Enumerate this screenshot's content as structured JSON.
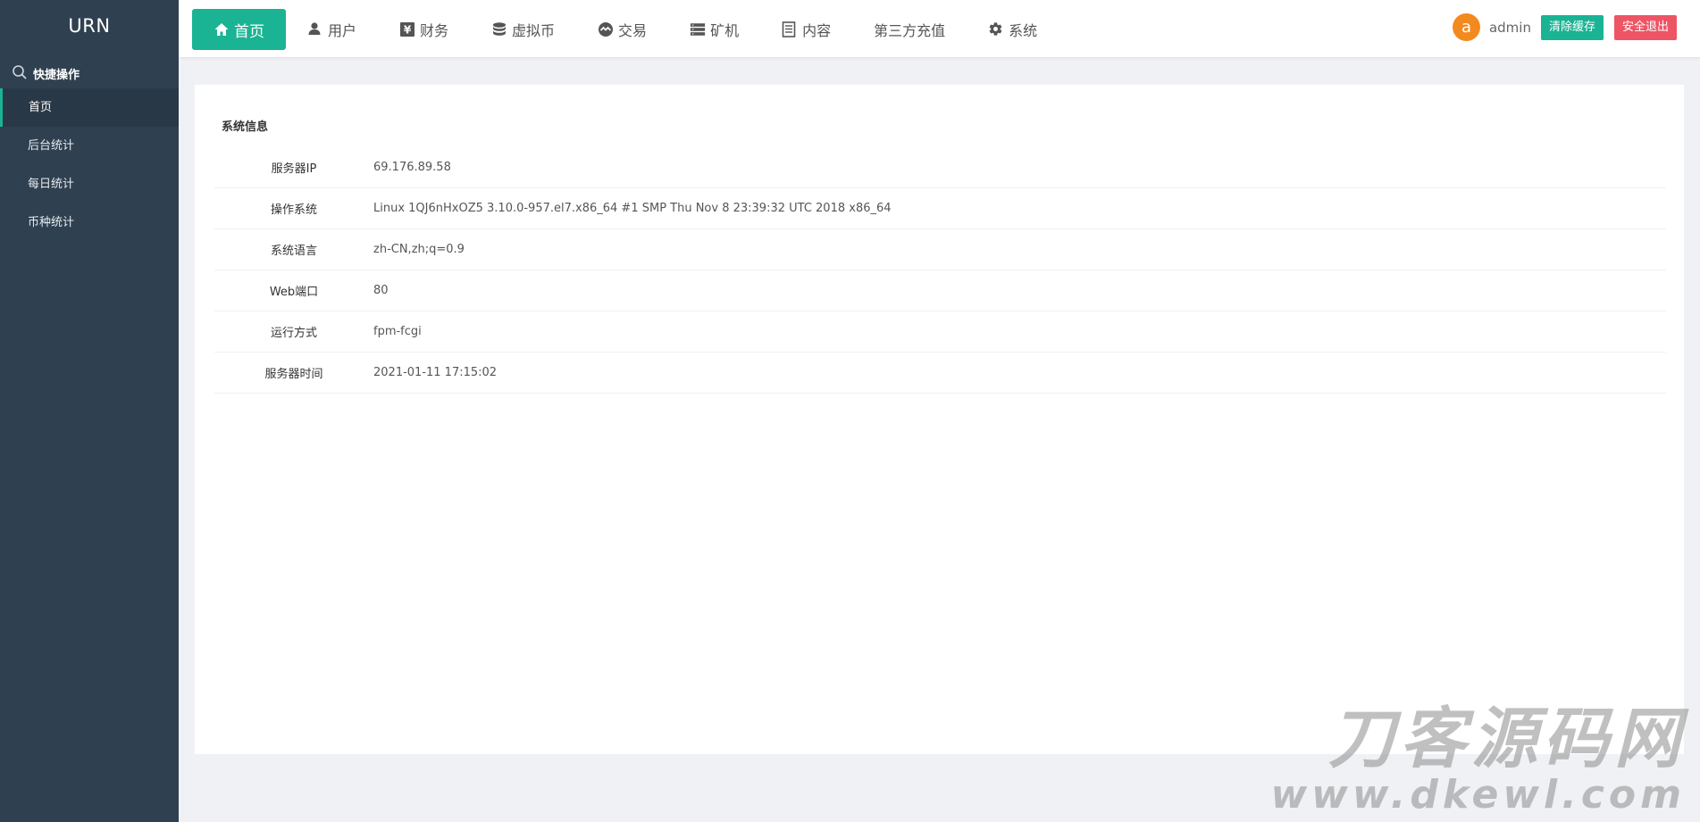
{
  "sidebar": {
    "brand": "URN",
    "quick_label": "快捷操作",
    "items": [
      {
        "label": "首页",
        "active": true
      },
      {
        "label": "后台统计"
      },
      {
        "label": "每日统计"
      },
      {
        "label": "币种统计"
      }
    ]
  },
  "topnav": {
    "tabs": [
      {
        "label": "首页",
        "icon": "home-icon",
        "active": true
      },
      {
        "label": "用户",
        "icon": "user-icon"
      },
      {
        "label": "财务",
        "icon": "yen-icon"
      },
      {
        "label": "虚拟币",
        "icon": "database-icon"
      },
      {
        "label": "交易",
        "icon": "exchange-icon"
      },
      {
        "label": "矿机",
        "icon": "server-icon"
      },
      {
        "label": "内容",
        "icon": "document-icon"
      },
      {
        "label": "第三方充值",
        "icon": ""
      },
      {
        "label": "系统",
        "icon": "gear-icon"
      }
    ]
  },
  "user": {
    "avatar_letter": "a",
    "name": "admin",
    "clear_cache_label": "清除缓存",
    "logout_label": "安全退出"
  },
  "panel": {
    "title": "系统信息",
    "rows": [
      {
        "key": "服务器IP",
        "value": "69.176.89.58"
      },
      {
        "key": "操作系统",
        "value": "Linux 1QJ6nHxOZ5 3.10.0-957.el7.x86_64 #1 SMP Thu Nov 8 23:39:32 UTC 2018 x86_64"
      },
      {
        "key": "系统语言",
        "value": "zh-CN,zh;q=0.9"
      },
      {
        "key": "Web端口",
        "value": "80"
      },
      {
        "key": "运行方式",
        "value": "fpm-fcgi"
      },
      {
        "key": "服务器时间",
        "value": "2021-01-11 17:15:02"
      }
    ]
  },
  "watermark": {
    "line1": "刀客源码网",
    "line2": "www.dkewl.com"
  },
  "colors": {
    "sidebar_bg": "#2f4050",
    "accent_green": "#1ab394",
    "danger_red": "#ed5565",
    "avatar_orange": "#f38a20"
  }
}
